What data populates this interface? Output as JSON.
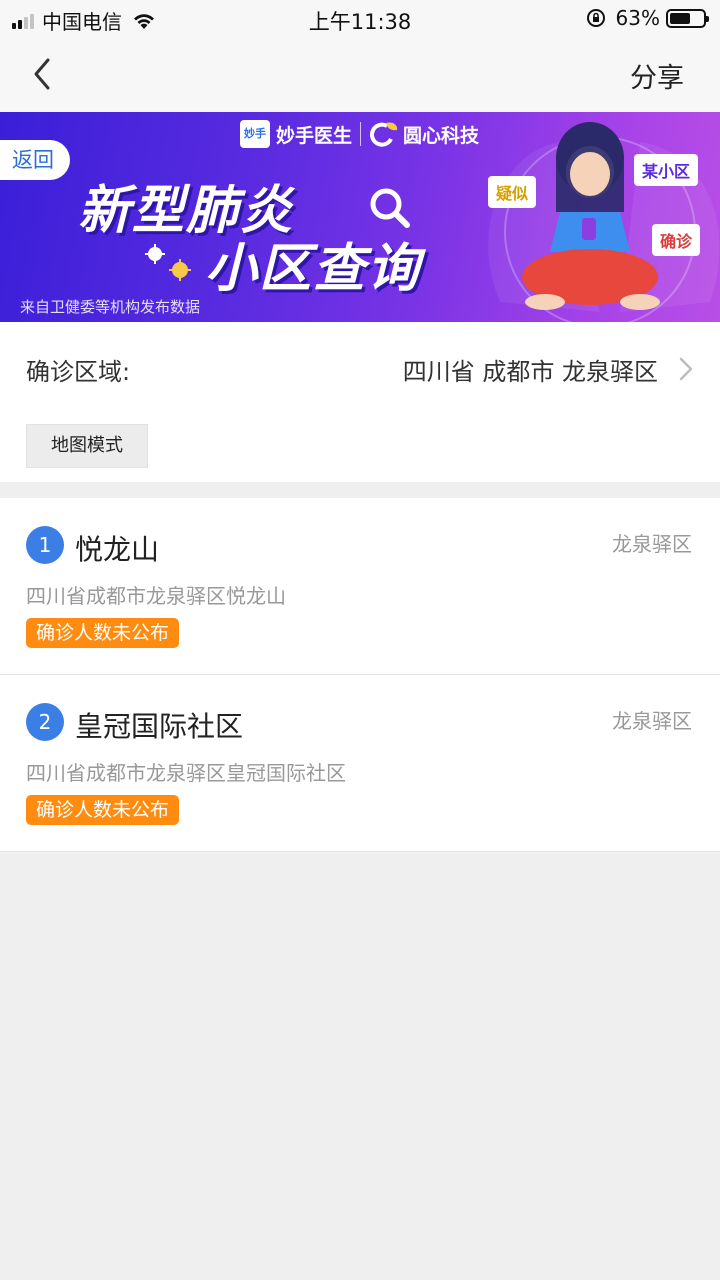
{
  "status_bar": {
    "carrier": "中国电信",
    "time": "上午11:38",
    "battery_percent": "63%",
    "battery_level": 0.63,
    "signal_bars_active": 2,
    "icons": [
      "signal-icon",
      "wifi-icon",
      "rotation-lock-icon",
      "battery-icon"
    ]
  },
  "nav": {
    "back_icon": "chevron-left-icon",
    "share_label": "分享"
  },
  "banner": {
    "back_label": "返回",
    "brand1_logo": "妙手",
    "brand1": "妙手医生",
    "brand2": "圆心科技",
    "title_line1": "新型肺炎",
    "title_line2": "小区查询",
    "caption": "来自卫健委等机构发布数据",
    "tags": [
      "疑似",
      "某小区",
      "确诊"
    ]
  },
  "region": {
    "label": "确诊区域:",
    "value": "四川省 成都市 龙泉驿区",
    "map_mode_label": "地图模式"
  },
  "list": {
    "items": [
      {
        "index": "1",
        "name": "悦龙山",
        "district": "龙泉驿区",
        "address": "四川省成都市龙泉驿区悦龙山",
        "status": "确诊人数未公布"
      },
      {
        "index": "2",
        "name": "皇冠国际社区",
        "district": "龙泉驿区",
        "address": "四川省成都市龙泉驿区皇冠国际社区",
        "status": "确诊人数未公布"
      }
    ]
  },
  "colors": {
    "accent_blue": "#3b7ee6",
    "status_orange": "#ff8c10",
    "banner_start": "#3a1fd8",
    "banner_end": "#b84fe6"
  }
}
